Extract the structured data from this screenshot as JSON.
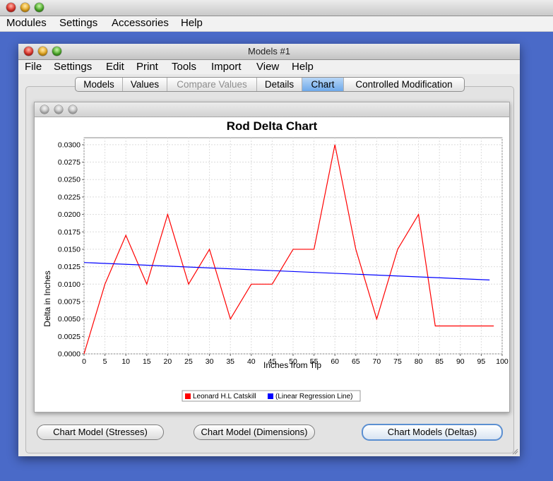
{
  "app_menubar": {
    "items": [
      "Modules",
      "Settings",
      "Accessories",
      "Help"
    ]
  },
  "window": {
    "title": "Models #1",
    "menubar": [
      "File",
      "Settings",
      "Edit",
      "Print",
      "Tools",
      "Import",
      "View",
      "Help"
    ],
    "tabs": [
      {
        "label": "Models",
        "state": "normal"
      },
      {
        "label": "Values",
        "state": "normal"
      },
      {
        "label": "Compare Values",
        "state": "disabled"
      },
      {
        "label": "Details",
        "state": "normal"
      },
      {
        "label": "Chart",
        "state": "selected"
      },
      {
        "label": "Controlled Modification",
        "state": "normal"
      }
    ],
    "buttons": {
      "stresses": "Chart Model (Stresses)",
      "dimensions": "Chart Model (Dimensions)",
      "deltas": "Chart Models (Deltas)"
    }
  },
  "colors": {
    "series_main": "#ff0000",
    "series_regression": "#0000ff",
    "tab_selected": "#6ea9ea"
  },
  "chart_data": {
    "type": "line",
    "title": "Rod Delta Chart",
    "xlabel": "Inches from Tip",
    "ylabel": "Delta in Inches",
    "xlim": [
      0,
      100
    ],
    "ylim": [
      0,
      0.031
    ],
    "x_ticks": [
      "0",
      "5",
      "10",
      "15",
      "20",
      "25",
      "30",
      "35",
      "40",
      "45",
      "50",
      "55",
      "60",
      "65",
      "70",
      "75",
      "80",
      "85",
      "90",
      "95",
      "100"
    ],
    "y_ticks": [
      "0.0000",
      "0.0025",
      "0.0050",
      "0.0075",
      "0.0100",
      "0.0125",
      "0.0150",
      "0.0175",
      "0.0200",
      "0.0225",
      "0.0250",
      "0.0275",
      "0.0300"
    ],
    "grid": true,
    "legend_position": "bottom",
    "series": [
      {
        "name": "Leonard H.L Catskill",
        "color": "#ff0000",
        "x": [
          0,
          5,
          10,
          15,
          20,
          25,
          30,
          35,
          40,
          45,
          50,
          55,
          60,
          65,
          70,
          75,
          80,
          84,
          98
        ],
        "y": [
          0.0,
          0.01,
          0.017,
          0.01,
          0.02,
          0.01,
          0.015,
          0.005,
          0.01,
          0.01,
          0.015,
          0.015,
          0.03,
          0.015,
          0.005,
          0.015,
          0.02,
          0.004,
          0.004
        ]
      },
      {
        "name": "(Linear Regression Line)",
        "color": "#0000ff",
        "x": [
          0,
          97
        ],
        "y": [
          0.0131,
          0.0106
        ]
      }
    ]
  }
}
